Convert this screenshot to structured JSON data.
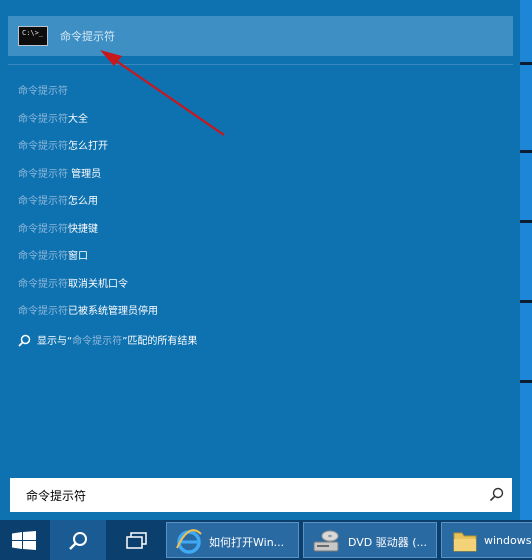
{
  "top_result": {
    "label": "命令提示符",
    "icon_text": "C:\\>_"
  },
  "suggestions": [
    {
      "query": "命令提示符",
      "suffix": ""
    },
    {
      "query": "命令提示符",
      "suffix": "大全"
    },
    {
      "query": "命令提示符",
      "suffix": "怎么打开"
    },
    {
      "query": "命令提示符",
      "suffix": " 管理员"
    },
    {
      "query": "命令提示符",
      "suffix": "怎么用"
    },
    {
      "query": "命令提示符",
      "suffix": "快捷键"
    },
    {
      "query": "命令提示符",
      "suffix": "窗口"
    },
    {
      "query": "命令提示符",
      "suffix": "取消关机口令"
    },
    {
      "query": "命令提示符",
      "suffix": "已被系统管理员停用"
    }
  ],
  "search_all": {
    "prefix": "显示与“",
    "query": "命令提示符",
    "suffix": "”匹配的所有结果"
  },
  "search_box": {
    "value": "命令提示符"
  },
  "taskbar": {
    "apps": [
      {
        "label": "如何打开Win...",
        "icon": "ie-icon"
      },
      {
        "label": "DVD 驱动器 (...",
        "icon": "dvd-drive-icon"
      },
      {
        "label": "windows",
        "icon": "folder-icon"
      }
    ]
  },
  "colors": {
    "panel": "#0e71b0",
    "highlight": "#3d8fc4",
    "query_text": "#8fb9da",
    "taskbar": "#0a3f6e",
    "arrow": "#d0161a"
  }
}
